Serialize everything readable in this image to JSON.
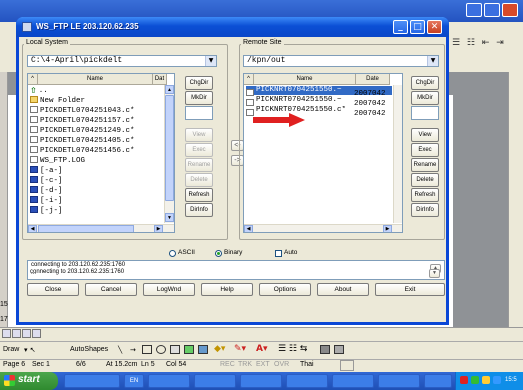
{
  "window": {
    "title": "WS_FTP LE 203.120.62.235",
    "controls": [
      "_",
      "□",
      "✕"
    ]
  },
  "local": {
    "label": "Local System",
    "path": "C:\\4-April\\pickdelt",
    "columns": [
      "^",
      "Name",
      "Dat"
    ],
    "rows": [
      {
        "name": "..",
        "icon": "up-arrow-icon"
      },
      {
        "name": "New Folder",
        "icon": "folder-icon"
      },
      {
        "name": "PICKDETL0704251043.c*",
        "icon": "file-icon"
      },
      {
        "name": "PICKDETL0704251157.c*",
        "icon": "file-icon"
      },
      {
        "name": "PICKDETL0704251249.c*",
        "icon": "file-icon"
      },
      {
        "name": "PICKDETL0704251405.c*",
        "icon": "file-icon"
      },
      {
        "name": "PICKDETL0704251456.c*",
        "icon": "file-icon"
      },
      {
        "name": "WS_FTP.LOG",
        "icon": "file-icon"
      },
      {
        "name": "[-a-]",
        "icon": "drive-icon"
      },
      {
        "name": "[-c-]",
        "icon": "drive-icon"
      },
      {
        "name": "[-d-]",
        "icon": "drive-icon"
      },
      {
        "name": "[-i-]",
        "icon": "drive-icon"
      },
      {
        "name": "[-j-]",
        "icon": "drive-icon"
      }
    ],
    "buttons": [
      "ChgDir",
      "MkDir",
      "",
      "View",
      "Exec",
      "Rename",
      "Delete",
      "Refresh",
      "DirInfo"
    ]
  },
  "remote": {
    "label": "Remote Site",
    "path": "/kpn/out",
    "columns": [
      "^",
      "Name",
      "Date"
    ],
    "rows": [
      {
        "name": "PICKNRT0704251550.~",
        "date": "2007042",
        "selected": true
      },
      {
        "name": "PICKNRT0704251550.~",
        "date": "2007042",
        "selected": false
      },
      {
        "name": "PICKNRT0704251550.c*",
        "date": "2007042",
        "selected": false
      }
    ],
    "buttons": [
      "ChgDir",
      "MkDir",
      "",
      "View",
      "Exec",
      "Rename",
      "Delete",
      "Refresh",
      "DirInfo"
    ]
  },
  "transfer": {
    "left_arrow": "<-",
    "right_arrow": "->"
  },
  "mode": {
    "ascii": "ASCII",
    "binary": "Binary",
    "auto": "Auto",
    "selected": "Binary",
    "auto_checked": false
  },
  "log": {
    "lines": [
      "connecting to 203.120.62.235:1760",
      "...",
      "connecting to 203.120.62.235:1760"
    ]
  },
  "bottom_buttons": [
    "Close",
    "Cancel",
    "LogWnd",
    "Help",
    "Options",
    "About",
    "Exit"
  ],
  "background_app": {
    "status": {
      "page": "Page 6",
      "sec": "Sec 1",
      "pages": "6/6",
      "at": "At 15.2cm",
      "ln": "Ln 5",
      "col": "Col 54",
      "flags": [
        "REC",
        "TRK",
        "EXT",
        "OVR"
      ],
      "lang": "Thai"
    },
    "draw_label": "Draw",
    "autoshapes_label": "AutoShapes",
    "start_label": "start",
    "side_numbers": [
      "15",
      "17"
    ],
    "tray_time": "15:5",
    "taskbar_items": [
      "EN"
    ]
  },
  "colors": {
    "titlebar": "#0b4fd5",
    "selection": "#316ac5",
    "annotation_arrow": "#e02020"
  }
}
